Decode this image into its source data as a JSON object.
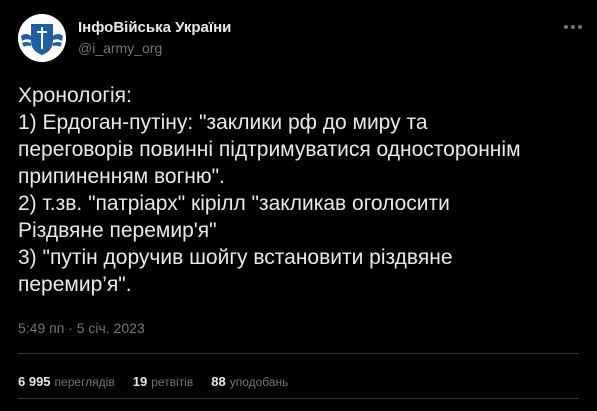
{
  "author": {
    "name": "ІнфоВійська України",
    "handle": "@i_army_org"
  },
  "tweet": {
    "lines": [
      "Хронологія:",
      "1) Ердоган-путіну: \"заклики рф до миру та",
      "переговорів повинні підтримуватися одностороннім",
      "припиненням вогню\".",
      "2) т.зв. \"патріарх\" кірілл \"закликав оголосити",
      "Різдвяне перемир'я\"",
      "3) \"путін доручив шойгу встановити різдвяне",
      "перемир’я\"."
    ],
    "timestamp": "5:49 пп · 5 січ. 2023"
  },
  "stats": {
    "views_count": "6 995",
    "views_label": "переглядів",
    "retweets_count": "19",
    "retweets_label": "ретвітів",
    "likes_count": "88",
    "likes_label": "уподобань"
  },
  "icons": {
    "avatar": "army-emblem-icon",
    "more": "more-dots-icon"
  },
  "colors": {
    "background": "#000000",
    "text": "#e7e9ea",
    "secondary": "#71767b",
    "divider": "#2f3336",
    "avatar_blue": "#1f5fa8"
  }
}
